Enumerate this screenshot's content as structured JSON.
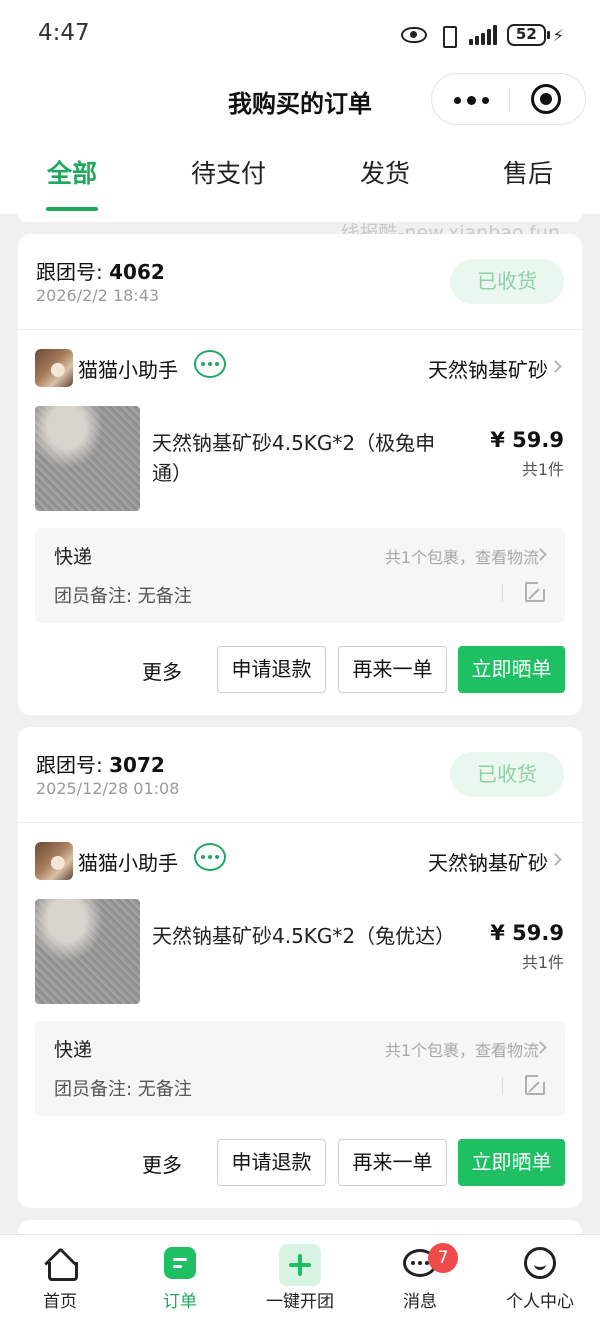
{
  "status_bar": {
    "time": "4:47",
    "battery": "52"
  },
  "header": {
    "title": "我购买的订单"
  },
  "tabs": [
    {
      "label": "全部",
      "active": true
    },
    {
      "label": "待支付",
      "active": false
    },
    {
      "label": "发货",
      "active": false
    },
    {
      "label": "售后",
      "active": false
    }
  ],
  "watermark": "线报酷-new.xianbao.fun",
  "orders": [
    {
      "group_label": "跟团号:",
      "group_id": "4062",
      "time": "2026/2/2 18:43",
      "status": "已收货",
      "merchant": "猫猫小助手",
      "store_link": "天然钠基矿砂",
      "product_title": "天然钠基矿砂4.5KG*2（极兔申通）",
      "price": "¥ 59.9",
      "quantity": "共1件",
      "shipping_label": "快递",
      "shipping_track": "共1个包裹，查看物流",
      "note": "团员备注: 无备注",
      "actions": {
        "more": "更多",
        "refund": "申请退款",
        "reorder": "再来一单",
        "review": "立即晒单"
      }
    },
    {
      "group_label": "跟团号:",
      "group_id": "3072",
      "time": "2025/12/28 01:08",
      "status": "已收货",
      "merchant": "猫猫小助手",
      "store_link": "天然钠基矿砂",
      "product_title": "天然钠基矿砂4.5KG*2（兔优达）",
      "price": "¥ 59.9",
      "quantity": "共1件",
      "shipping_label": "快递",
      "shipping_track": "共1个包裹，查看物流",
      "note": "团员备注: 无备注",
      "actions": {
        "more": "更多",
        "refund": "申请退款",
        "reorder": "再来一单",
        "review": "立即晒单"
      }
    }
  ],
  "bottom_nav": [
    {
      "label": "首页",
      "icon": "home-icon"
    },
    {
      "label": "订单",
      "icon": "order-icon",
      "active": true
    },
    {
      "label": "一键开团",
      "icon": "plus-icon"
    },
    {
      "label": "消息",
      "icon": "message-icon",
      "badge": "7"
    },
    {
      "label": "个人中心",
      "icon": "user-icon"
    }
  ],
  "colors": {
    "accent": "#1fa95c",
    "button_primary": "#1fbf63",
    "badge": "#f04a4a",
    "status_badge_bg": "#e9f7ee"
  }
}
